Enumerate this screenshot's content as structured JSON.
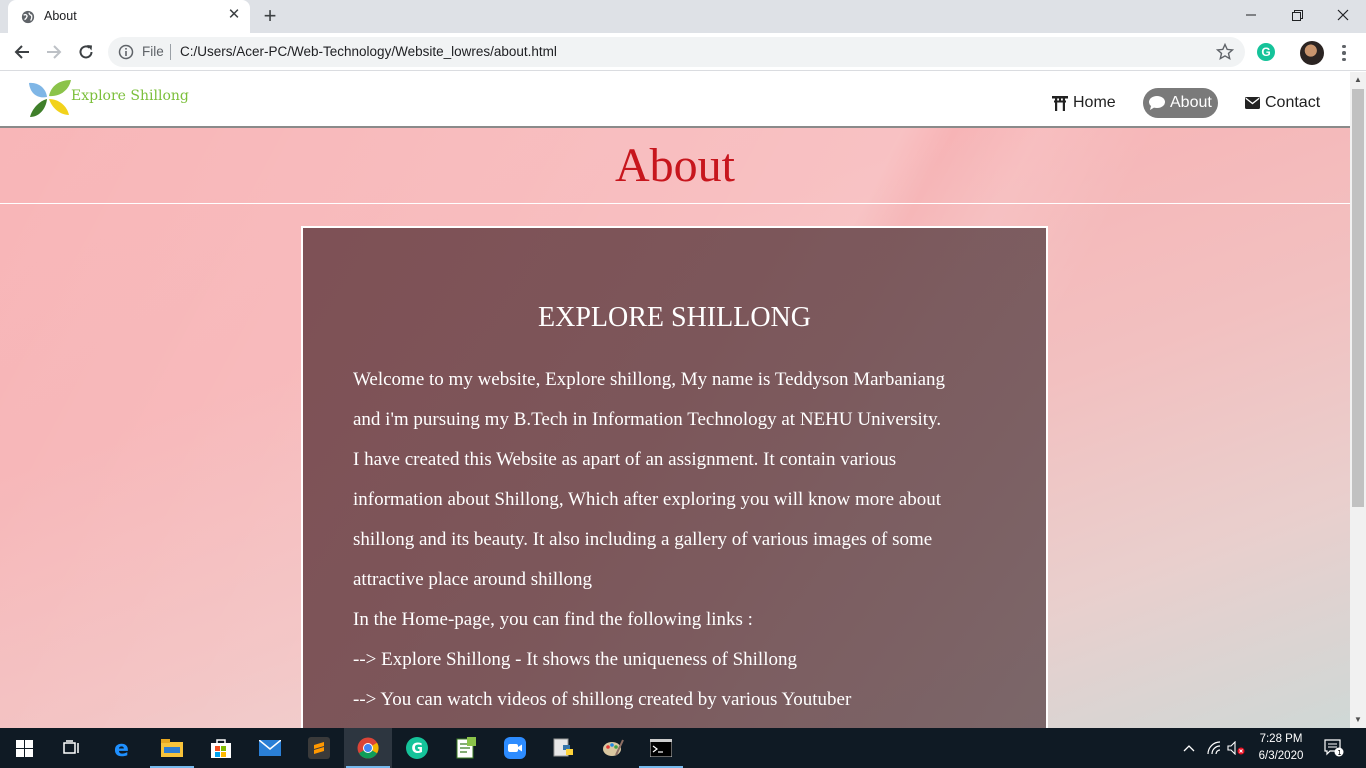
{
  "browser": {
    "tab_title": "About",
    "omnibox_scheme": "File",
    "url": "C:/Users/Acer-PC/Web-Technology/Website_lowres/about.html",
    "extension_letter": "G"
  },
  "site": {
    "logo_text": "Explore Shillong",
    "nav": [
      {
        "label": "Home",
        "icon": "torii-gate-icon",
        "active": false
      },
      {
        "label": "About",
        "icon": "comment-icon",
        "active": true
      },
      {
        "label": "Contact",
        "icon": "envelope-icon",
        "active": false
      }
    ],
    "page_title": "About",
    "title_color": "#c7161d",
    "box": {
      "heading": "EXPLORE SHILLONG",
      "lines": [
        "Welcome to my website, Explore shillong, My name is Teddyson Marbaniang",
        "and i'm pursuing my B.Tech in Information Technology at NEHU University.",
        "I have created this Website as apart of an assignment. It contain various",
        "information about Shillong, Which after exploring you will know more about",
        "shillong and its beauty. It also including a gallery of various images of some",
        "attractive place around shillong",
        "In the Home-page, you can find the following links :",
        "--> Explore Shillong - It shows the uniqueness of Shillong",
        "--> You can watch videos of shillong created by various Youtuber"
      ]
    }
  },
  "taskbar": {
    "time": "7:28 PM",
    "date": "6/3/2020",
    "notification_count": "1",
    "apps": [
      "windows-start-icon",
      "task-view-icon",
      "edge-icon",
      "file-explorer-icon",
      "store-icon",
      "mail-icon",
      "sublime-text-icon",
      "chrome-icon",
      "grammarly-icon",
      "notepad-plus-icon",
      "zoom-icon",
      "python-icon",
      "paint-icon",
      "command-prompt-icon"
    ]
  }
}
